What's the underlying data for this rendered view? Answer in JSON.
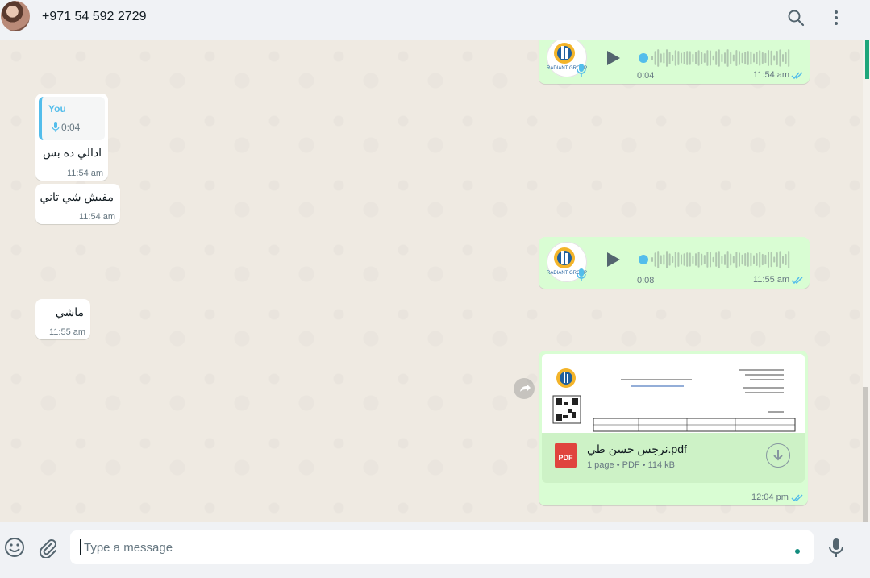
{
  "header": {
    "contact_name": "+971 54 592 2729",
    "icons": [
      "search-icon",
      "menu-icon"
    ]
  },
  "messages": [
    {
      "id": "voice1",
      "direction": "out",
      "type": "voice",
      "duration": "0:04",
      "time": "11:54 am",
      "status": "read",
      "avatar_brand": "RADIANT GROUP"
    },
    {
      "id": "reply1",
      "direction": "in",
      "type": "text",
      "quote_author": "You",
      "quote_duration": "0:04",
      "text": "ادالي ده بس",
      "time": "11:54 am"
    },
    {
      "id": "text2",
      "direction": "in",
      "type": "text",
      "text": "مفيش شي تاني",
      "time": "11:54 am"
    },
    {
      "id": "voice2",
      "direction": "out",
      "type": "voice",
      "duration": "0:08",
      "time": "11:55 am",
      "status": "read",
      "avatar_brand": "RADIANT GROUP"
    },
    {
      "id": "text3",
      "direction": "in",
      "type": "text",
      "text": "ماشي",
      "time": "11:55 am"
    },
    {
      "id": "doc1",
      "direction": "out",
      "type": "document",
      "file_name": "نرجس حسن طي.pdf",
      "file_meta": "1 page • PDF • 114 kB",
      "file_badge": "PDF",
      "time": "12:04 pm",
      "status": "read"
    }
  ],
  "composer": {
    "placeholder": "Type a message",
    "icons": [
      "emoji-icon",
      "attach-icon",
      "mic-icon"
    ]
  },
  "colors": {
    "outgoing_bubble": "#d9fdd3",
    "incoming_bubble": "#ffffff",
    "read_ticks": "#53bdeb",
    "accent": "#1ea67a",
    "pdf_badge": "#e0443e"
  }
}
